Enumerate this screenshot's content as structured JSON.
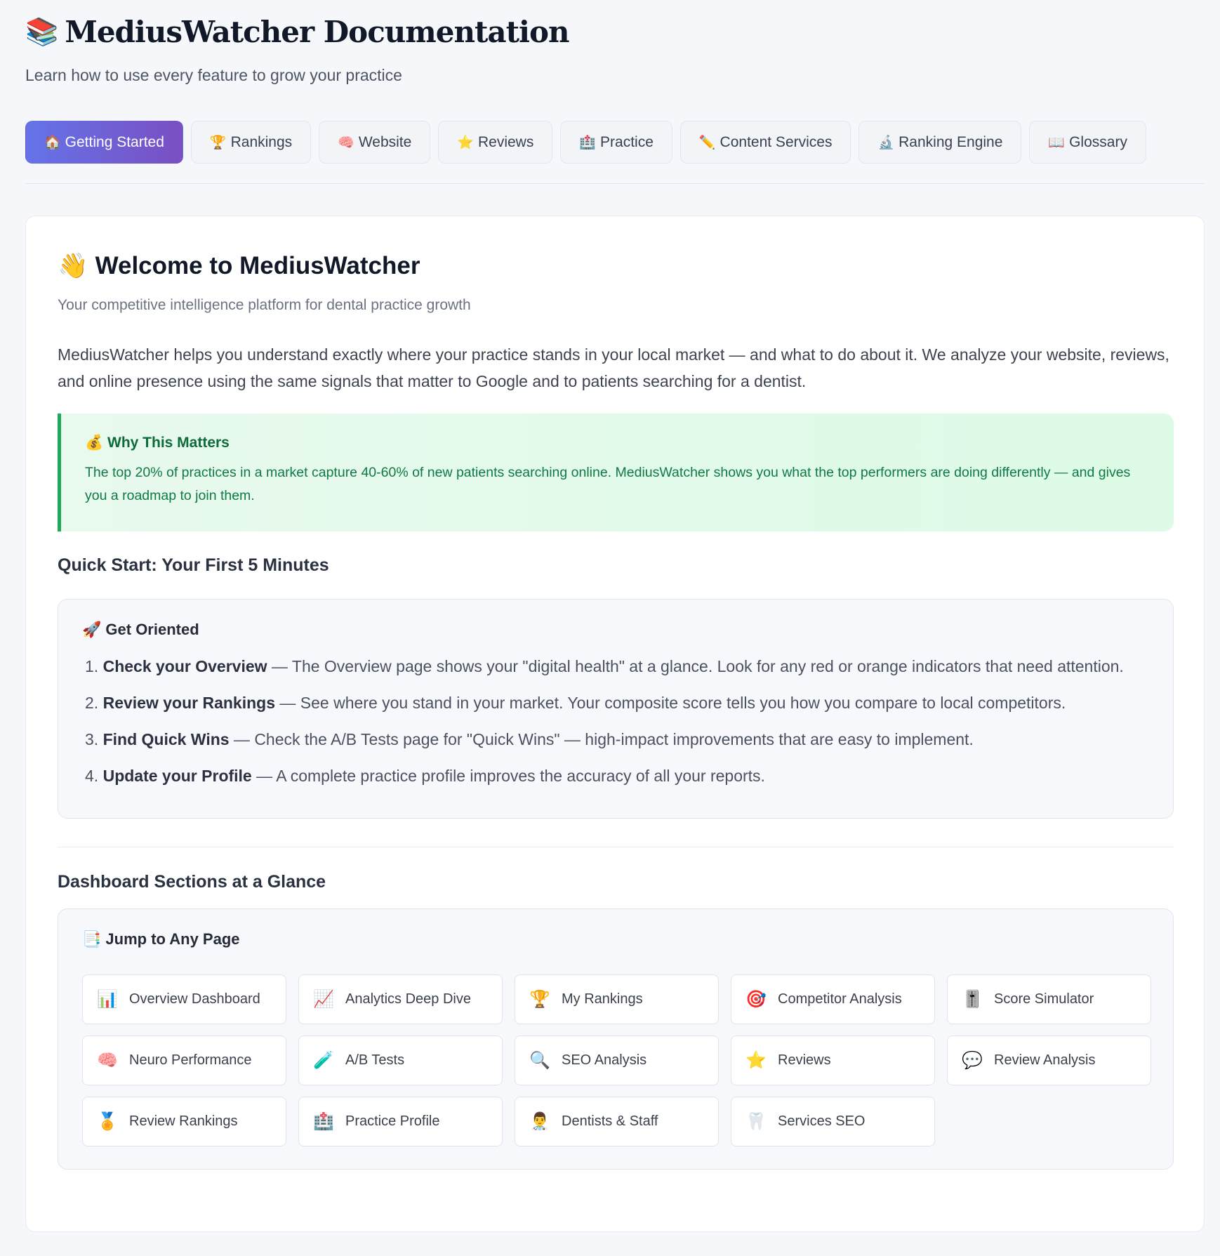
{
  "header": {
    "icon": "books-icon",
    "title": "MediusWatcher Documentation",
    "subtitle": "Learn how to use every feature to grow your practice"
  },
  "tabs": [
    {
      "icon": "house-icon",
      "glyph": "🏠",
      "label": "Getting Started",
      "active": true
    },
    {
      "icon": "trophy-icon",
      "glyph": "🏆",
      "label": "Rankings",
      "active": false
    },
    {
      "icon": "brain-icon",
      "glyph": "🧠",
      "label": "Website",
      "active": false
    },
    {
      "icon": "star-icon",
      "glyph": "⭐",
      "label": "Reviews",
      "active": false
    },
    {
      "icon": "hospital-icon",
      "glyph": "🏥",
      "label": "Practice",
      "active": false
    },
    {
      "icon": "pencil-icon",
      "glyph": "✏️",
      "label": "Content Services",
      "active": false
    },
    {
      "icon": "microscope-icon",
      "glyph": "🔬",
      "label": "Ranking Engine",
      "active": false
    },
    {
      "icon": "open-book-icon",
      "glyph": "📖",
      "label": "Glossary",
      "active": false
    }
  ],
  "welcome": {
    "icon": "waving-hand-icon",
    "title": "Welcome to MediusWatcher",
    "subtitle": "Your competitive intelligence platform for dental practice growth",
    "intro": "MediusWatcher helps you understand exactly where your practice stands in your local market — and what to do about it. We analyze your website, reviews, and online presence using the same signals that matter to Google and to patients searching for a dentist."
  },
  "callout": {
    "icon": "money-bag-icon",
    "title": "Why This Matters",
    "body": "The top 20% of practices in a market capture 40-60% of new patients searching online. MediusWatcher shows you what the top performers are doing differently — and gives you a roadmap to join them."
  },
  "quick_start": {
    "heading": "Quick Start: Your First 5 Minutes",
    "panel_icon": "rocket-icon",
    "panel_title": "Get Oriented",
    "steps": [
      {
        "num": "1.",
        "title": "Check your Overview",
        "text": " — The Overview page shows your \"digital health\" at a glance. Look for any red or orange indicators that need attention."
      },
      {
        "num": "2.",
        "title": "Review your Rankings",
        "text": " — See where you stand in your market. Your composite score tells you how you compare to local competitors."
      },
      {
        "num": "3.",
        "title": "Find Quick Wins",
        "text": " — Check the A/B Tests page for \"Quick Wins\" — high-impact improvements that are easy to implement."
      },
      {
        "num": "4.",
        "title": "Update your Profile",
        "text": " — A complete practice profile improves the accuracy of all your reports."
      }
    ]
  },
  "dashboard": {
    "heading": "Dashboard Sections at a Glance",
    "panel_icon": "bookmark-tabs-icon",
    "panel_title": "Jump to Any Page",
    "pages": [
      {
        "icon": "bar-chart-icon",
        "glyph": "📊",
        "label": "Overview Dashboard"
      },
      {
        "icon": "trend-chart-icon",
        "glyph": "📈",
        "label": "Analytics Deep Dive"
      },
      {
        "icon": "trophy-icon",
        "glyph": "🏆",
        "label": "My Rankings"
      },
      {
        "icon": "target-icon",
        "glyph": "🎯",
        "label": "Competitor Analysis"
      },
      {
        "icon": "slider-icon",
        "glyph": "🎚️",
        "label": "Score Simulator"
      },
      {
        "icon": "brain-icon",
        "glyph": "🧠",
        "label": "Neuro Performance"
      },
      {
        "icon": "test-tube-icon",
        "glyph": "🧪",
        "label": "A/B Tests"
      },
      {
        "icon": "magnifier-icon",
        "glyph": "🔍",
        "label": "SEO Analysis"
      },
      {
        "icon": "star-icon",
        "glyph": "⭐",
        "label": "Reviews"
      },
      {
        "icon": "speech-bubble-icon",
        "glyph": "💬",
        "label": "Review Analysis"
      },
      {
        "icon": "medal-icon",
        "glyph": "🏅",
        "label": "Review Rankings"
      },
      {
        "icon": "hospital-icon",
        "glyph": "🏥",
        "label": "Practice Profile"
      },
      {
        "icon": "doctor-icon",
        "glyph": "👨‍⚕️",
        "label": "Dentists & Staff"
      },
      {
        "icon": "tooth-icon",
        "glyph": "🦷",
        "label": "Services SEO"
      }
    ]
  },
  "colors": {
    "tab_active_start": "#6474e8",
    "tab_active_end": "#7a4fc2",
    "callout_border": "#1faa5b",
    "callout_text": "#0f7a45"
  }
}
